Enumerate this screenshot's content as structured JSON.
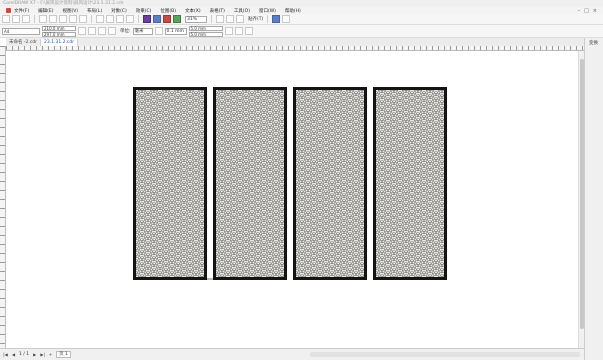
{
  "window": {
    "title": "CorelDRAW X7 - F:\\屏风设计资料\\屏风设计\\23.1.31.2.cdr"
  },
  "menubar": {
    "items": [
      "文件(F)",
      "编辑(E)",
      "视图(V)",
      "布局(L)",
      "对象(C)",
      "效果(C)",
      "位图(B)",
      "文本(X)",
      "表格(T)",
      "工具(O)",
      "窗口(W)",
      "帮助(H)"
    ]
  },
  "toolbar": {
    "zoom": "31%",
    "snap": "贴齐(T)"
  },
  "property_bar": {
    "page_size": "A4",
    "width": "210.0 mm",
    "height": "297.0 mm",
    "units_label": "单位:",
    "units": "毫米",
    "nudge": "0.1 mm",
    "dup_x": "5.0 mm",
    "dup_y": "5.0 mm"
  },
  "doc_tabs": [
    "未命名 -2.cdr",
    "23.1.31.2.cdr"
  ],
  "right_dock": {
    "label": "变换"
  },
  "status": {
    "page_indicator": "1 / 1",
    "page_tab": "页 1"
  }
}
